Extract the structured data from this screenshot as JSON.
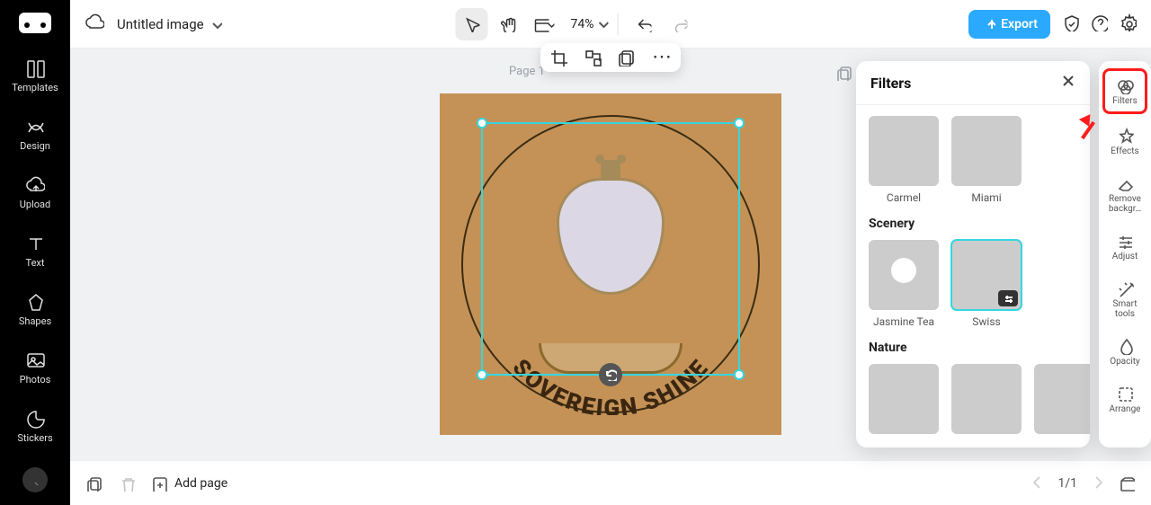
{
  "doc": {
    "title": "Untitled image"
  },
  "topbar": {
    "zoom": "74%",
    "export": "Export"
  },
  "nav": {
    "items": [
      {
        "label": "Templates"
      },
      {
        "label": "Design"
      },
      {
        "label": "Upload"
      },
      {
        "label": "Text"
      },
      {
        "label": "Shapes"
      },
      {
        "label": "Photos"
      },
      {
        "label": "Stickers"
      }
    ]
  },
  "canvas": {
    "page_label": "Page 1",
    "art_text": "SOVEREIGN SHINE"
  },
  "panel": {
    "title": "Filters",
    "row1": [
      {
        "name": "Carmel"
      },
      {
        "name": "Miami"
      }
    ],
    "sections": [
      {
        "heading": "Scenery",
        "items": [
          {
            "name": "Jasmine Tea"
          },
          {
            "name": "Swiss"
          }
        ]
      },
      {
        "heading": "Nature",
        "items": [
          {
            "name": ""
          },
          {
            "name": ""
          },
          {
            "name": ""
          }
        ]
      }
    ]
  },
  "rail": {
    "items": [
      {
        "label": "Filters"
      },
      {
        "label": "Effects"
      },
      {
        "label": "Remove backgr…"
      },
      {
        "label": "Adjust"
      },
      {
        "label": "Smart tools"
      },
      {
        "label": "Opacity"
      },
      {
        "label": "Arrange"
      }
    ]
  },
  "bottom": {
    "add_page": "Add page",
    "pager": "1/1"
  }
}
